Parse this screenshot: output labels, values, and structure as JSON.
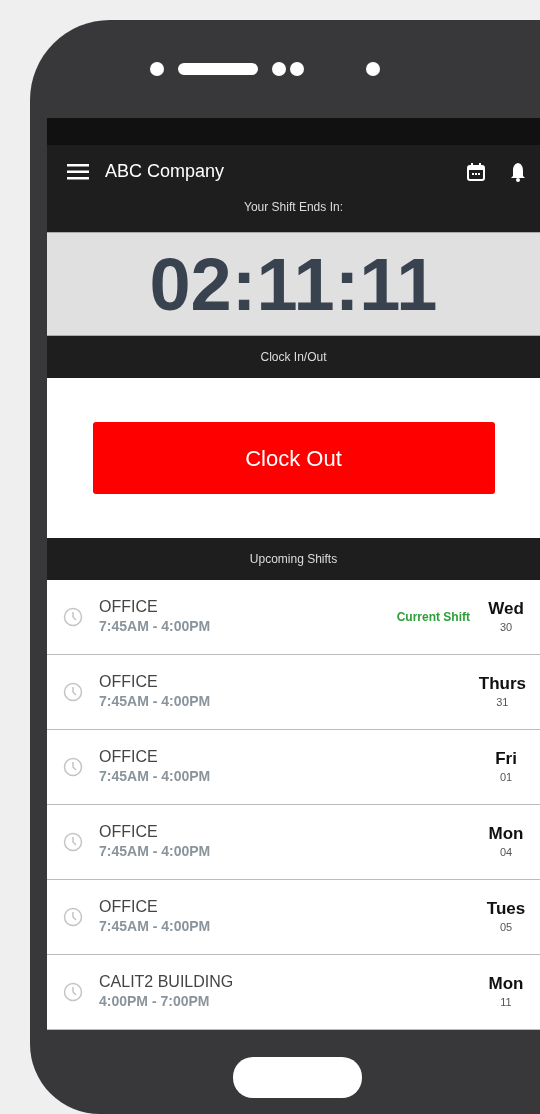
{
  "app_bar": {
    "title": "ABC Company"
  },
  "countdown": {
    "label": "Your Shift Ends In:",
    "time": "02:11:11"
  },
  "clock_section": {
    "header": "Clock In/Out",
    "button": "Clock Out"
  },
  "shifts_section": {
    "header": "Upcoming Shifts",
    "rows": [
      {
        "location": "OFFICE",
        "hours": "7:45AM - 4:00PM",
        "tag": "Current Shift",
        "day": "Wed",
        "date": "30"
      },
      {
        "location": "OFFICE",
        "hours": "7:45AM - 4:00PM",
        "day": "Thurs",
        "date": "31"
      },
      {
        "location": "OFFICE",
        "hours": "7:45AM - 4:00PM",
        "day": "Fri",
        "date": "01"
      },
      {
        "location": "OFFICE",
        "hours": "7:45AM - 4:00PM",
        "day": "Mon",
        "date": "04"
      },
      {
        "location": "OFFICE",
        "hours": "7:45AM - 4:00PM",
        "day": "Tues",
        "date": "05"
      },
      {
        "location": "CALIT2 BUILDING",
        "hours": "4:00PM - 7:00PM",
        "day": "Mon",
        "date": "11"
      }
    ]
  }
}
